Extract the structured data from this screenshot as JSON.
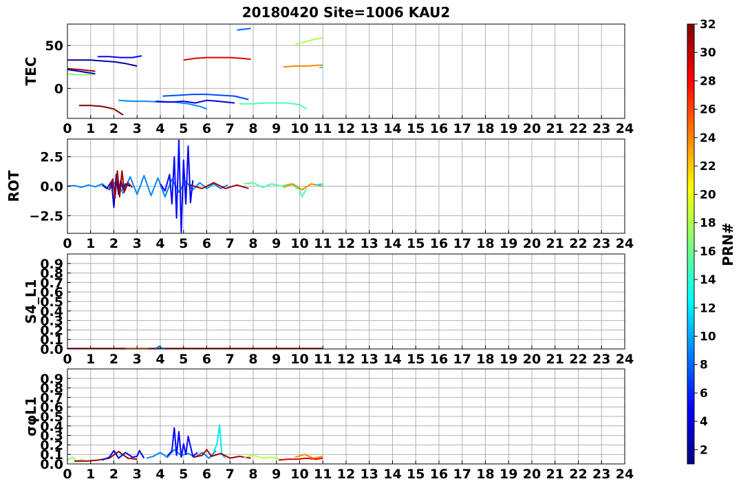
{
  "figure": {
    "title": "20180420 Site=1006 KAU2"
  },
  "colors": {
    "grid": "#b0b0b0",
    "jet": [
      "#00007f",
      "#0000ff",
      "#007fff",
      "#00ffff",
      "#7fff7f",
      "#ffff00",
      "#ff7f00",
      "#ff0000",
      "#7f0000"
    ]
  },
  "colorbar": {
    "label": "PRN#",
    "range": [
      1,
      32
    ],
    "ticks": [
      2,
      4,
      6,
      8,
      10,
      12,
      14,
      16,
      18,
      20,
      22,
      24,
      26,
      28,
      30,
      32
    ]
  },
  "chart_data": [
    {
      "type": "line",
      "ylabel": "TEC",
      "xlim": [
        0,
        24
      ],
      "ylim": [
        -35,
        75
      ],
      "xticks": [
        0,
        1,
        2,
        3,
        4,
        5,
        6,
        7,
        8,
        9,
        10,
        11,
        12,
        13,
        14,
        15,
        16,
        17,
        18,
        19,
        20,
        21,
        22,
        23,
        24
      ],
      "yticks": [
        {
          "v": 0,
          "label": "0"
        },
        {
          "v": 50,
          "label": "50"
        }
      ],
      "grid": true,
      "series": [
        {
          "prn": 31,
          "x": [
            0,
            0.5,
            1.2
          ],
          "y": [
            23,
            22,
            20
          ]
        },
        {
          "prn": 3,
          "x": [
            0,
            0.5,
            1.2
          ],
          "y": [
            22,
            20,
            17
          ]
        },
        {
          "prn": 17,
          "x": [
            0,
            0.5,
            1.1
          ],
          "y": [
            17,
            16,
            16
          ]
        },
        {
          "prn": 2,
          "x": [
            0,
            0.5,
            1,
            1.5,
            2,
            2.5,
            3
          ],
          "y": [
            33,
            33,
            33,
            32,
            31,
            29,
            26
          ]
        },
        {
          "prn": 5,
          "x": [
            1.3,
            1.8,
            2.3,
            2.8,
            3.2
          ],
          "y": [
            37,
            37,
            36,
            36,
            38
          ]
        },
        {
          "prn": 32,
          "x": [
            0.5,
            1,
            1.5,
            2,
            2.4
          ],
          "y": [
            -20,
            -20,
            -21,
            -24,
            -31
          ]
        },
        {
          "prn": 9,
          "x": [
            2.2,
            2.8,
            3.4,
            4,
            4.6,
            5.2,
            5.7,
            6
          ],
          "y": [
            -14,
            -15,
            -15,
            -16,
            -16,
            -18,
            -21,
            -24
          ]
        },
        {
          "prn": 4,
          "x": [
            3.8,
            4.5,
            5,
            5.5,
            6,
            6.5,
            7.2
          ],
          "y": [
            -15,
            -16,
            -15,
            -17,
            -14,
            -15,
            -17
          ]
        },
        {
          "prn": 7,
          "x": [
            4.1,
            4.8,
            5.4,
            6,
            6.6,
            7.2,
            7.8
          ],
          "y": [
            -9,
            -8,
            -7,
            -7,
            -8,
            -9,
            -13
          ]
        },
        {
          "prn": 29,
          "x": [
            5,
            5.5,
            6,
            6.5,
            7,
            7.5,
            7.9
          ],
          "y": [
            33,
            35,
            36,
            36,
            36,
            35,
            34
          ]
        },
        {
          "prn": 8,
          "x": [
            7.3,
            7.6,
            7.9
          ],
          "y": [
            68,
            69,
            70
          ]
        },
        {
          "prn": 15,
          "x": [
            7.4,
            8,
            8.5,
            9,
            9.5,
            10,
            10.3
          ],
          "y": [
            -18,
            -18,
            -17,
            -17,
            -17,
            -19,
            -24
          ]
        },
        {
          "prn": 24,
          "x": [
            9.3,
            9.8,
            10.3,
            10.8,
            11
          ],
          "y": [
            25,
            26,
            26,
            27,
            27
          ]
        },
        {
          "prn": 18,
          "x": [
            9.8,
            10.2,
            10.6,
            11
          ],
          "y": [
            51,
            54,
            57,
            59
          ]
        },
        {
          "prn": 12,
          "x": [
            10.85,
            11
          ],
          "y": [
            24,
            25
          ]
        }
      ]
    },
    {
      "type": "line",
      "ylabel": "ROT",
      "xlim": [
        0,
        24
      ],
      "ylim": [
        -4,
        4
      ],
      "xticks": [
        0,
        1,
        2,
        3,
        4,
        5,
        6,
        7,
        8,
        9,
        10,
        11,
        12,
        13,
        14,
        15,
        16,
        17,
        18,
        19,
        20,
        21,
        22,
        23,
        24
      ],
      "yticks": [
        {
          "v": 2.5,
          "label": "2.5"
        },
        {
          "v": 0,
          "label": "0.0"
        },
        {
          "v": -2.5,
          "label": "−2.5"
        }
      ],
      "grid": true,
      "series": [
        {
          "prn": 9,
          "x": [
            0,
            0.3,
            0.6,
            0.9,
            1.2,
            1.5,
            1.8,
            2.1,
            2.4,
            2.7,
            3,
            3.3,
            3.6,
            3.9,
            4.2,
            4.5,
            4.8,
            5.1,
            5.4,
            5.7,
            6,
            6.3,
            6.6,
            6.9
          ],
          "y": [
            0,
            0.05,
            -0.1,
            0.1,
            -0.05,
            0.2,
            -0.3,
            0.4,
            -0.6,
            0.8,
            -0.7,
            0.9,
            -0.8,
            0.7,
            -0.9,
            0.6,
            -0.5,
            0.4,
            -0.3,
            0.3,
            -0.2,
            0.2,
            -0.2,
            0.1
          ]
        },
        {
          "prn": 3,
          "x": [
            1.5,
            1.7,
            1.9,
            2,
            2.1,
            2.2,
            2.3,
            2.4,
            2.5,
            2.7
          ],
          "y": [
            0.1,
            -0.2,
            0.4,
            -1.8,
            1,
            -0.7,
            0.5,
            -0.3,
            0.2,
            0
          ]
        },
        {
          "prn": 31,
          "x": [
            1.8,
            1.95,
            2.05,
            2.15,
            2.25,
            2.35,
            2.45,
            2.6,
            2.8
          ],
          "y": [
            -0.3,
            0.6,
            -1,
            1.3,
            -0.9,
            1.3,
            -0.5,
            0.3,
            -0.1
          ]
        },
        {
          "prn": 5,
          "x": [
            4,
            4.2,
            4.4,
            4.5,
            4.6,
            4.7,
            4.8,
            4.9,
            5,
            5.1,
            5.2,
            5.3,
            5.4
          ],
          "y": [
            0.2,
            -0.4,
            1,
            -1.5,
            2.5,
            -2.7,
            3.9,
            -3.9,
            2.2,
            -1.5,
            3.4,
            -1.4,
            0.5
          ]
        },
        {
          "prn": 31,
          "x": [
            5.3,
            5.8,
            6.3,
            6.8,
            7.3,
            7.8
          ],
          "y": [
            0.1,
            -0.2,
            0.3,
            -0.2,
            0.1,
            -0.2
          ]
        },
        {
          "prn": 15,
          "x": [
            7.6,
            8,
            8.4,
            8.8,
            9.2,
            9.6,
            10,
            10.1,
            10.3
          ],
          "y": [
            0.2,
            0.3,
            -0.1,
            0.2,
            0,
            0.2,
            -0.3,
            -0.9,
            -0.2
          ]
        },
        {
          "prn": 24,
          "x": [
            9.3,
            9.7,
            10.1,
            10.5,
            11
          ],
          "y": [
            -0.1,
            0.2,
            -0.3,
            0.2,
            0
          ]
        },
        {
          "prn": 12,
          "x": [
            10.7,
            11
          ],
          "y": [
            0.1,
            0.2
          ]
        }
      ]
    },
    {
      "type": "line",
      "ylabel": "S4_L1",
      "xlim": [
        0,
        24
      ],
      "ylim": [
        0,
        1
      ],
      "xticks": [
        0,
        1,
        2,
        3,
        4,
        5,
        6,
        7,
        8,
        9,
        10,
        11,
        12,
        13,
        14,
        15,
        16,
        17,
        18,
        19,
        20,
        21,
        22,
        23,
        24
      ],
      "yticks": [
        {
          "v": 0,
          "label": "0.0"
        },
        {
          "v": 0.1,
          "label": "0.1"
        },
        {
          "v": 0.2,
          "label": "0.2"
        },
        {
          "v": 0.3,
          "label": "0.3"
        },
        {
          "v": 0.4,
          "label": "0.4"
        },
        {
          "v": 0.5,
          "label": "0.5"
        },
        {
          "v": 0.6,
          "label": "0.6"
        },
        {
          "v": 0.7,
          "label": "0.7"
        },
        {
          "v": 0.8,
          "label": "0.8"
        },
        {
          "v": 0.9,
          "label": "0.9"
        }
      ],
      "grid": true,
      "series": [
        {
          "prn": 31,
          "x": [
            0,
            2,
            4,
            6,
            8,
            10,
            11
          ],
          "y": [
            0.005,
            0.005,
            0.005,
            0.005,
            0.005,
            0.005,
            0.005
          ]
        },
        {
          "prn": 9,
          "x": [
            3.8,
            3.95,
            4.05,
            4.2
          ],
          "y": [
            0.005,
            0.03,
            0.01,
            0.005
          ]
        },
        {
          "prn": 24,
          "x": [
            2.5,
            3.5
          ],
          "y": [
            0.005,
            0.005
          ]
        }
      ]
    },
    {
      "type": "line",
      "ylabel": "σφL1",
      "xlim": [
        0,
        24
      ],
      "ylim": [
        0,
        1
      ],
      "xticks": [
        0,
        1,
        2,
        3,
        4,
        5,
        6,
        7,
        8,
        9,
        10,
        11,
        12,
        13,
        14,
        15,
        16,
        17,
        18,
        19,
        20,
        21,
        22,
        23,
        24
      ],
      "yticks": [
        {
          "v": 0,
          "label": "0.0"
        },
        {
          "v": 0.1,
          "label": "0.1"
        },
        {
          "v": 0.2,
          "label": "0.2"
        },
        {
          "v": 0.3,
          "label": "0.3"
        },
        {
          "v": 0.4,
          "label": "0.4"
        },
        {
          "v": 0.5,
          "label": "0.5"
        },
        {
          "v": 0.6,
          "label": "0.6"
        },
        {
          "v": 0.7,
          "label": "0.7"
        },
        {
          "v": 0.8,
          "label": "0.8"
        },
        {
          "v": 0.9,
          "label": "0.9"
        }
      ],
      "grid": true,
      "series": [
        {
          "prn": 17,
          "x": [
            0,
            0.2,
            0.4,
            0.7
          ],
          "y": [
            0.04,
            0.07,
            0.03,
            0.05
          ]
        },
        {
          "prn": 31,
          "x": [
            0.3,
            0.8,
            1.3,
            1.8,
            2.2,
            2.6,
            3
          ],
          "y": [
            0.03,
            0.03,
            0.04,
            0.06,
            0.13,
            0.06,
            0.05
          ]
        },
        {
          "prn": 4,
          "x": [
            1.5,
            1.8,
            2,
            2.2,
            2.5,
            2.8,
            3,
            3.1,
            3.3
          ],
          "y": [
            0.04,
            0.07,
            0.14,
            0.06,
            0.12,
            0.07,
            0.08,
            0.14,
            0.06
          ]
        },
        {
          "prn": 9,
          "x": [
            3.4,
            3.7,
            4,
            4.3,
            4.6,
            4.9,
            5.2,
            5.5,
            5.8,
            6.1,
            6.4
          ],
          "y": [
            0.06,
            0.08,
            0.12,
            0.07,
            0.15,
            0.09,
            0.11,
            0.07,
            0.12,
            0.06,
            0.14
          ]
        },
        {
          "prn": 5,
          "x": [
            4.3,
            4.5,
            4.6,
            4.7,
            4.8,
            4.9,
            5,
            5.1,
            5.2,
            5.4,
            5.6
          ],
          "y": [
            0.08,
            0.14,
            0.38,
            0.09,
            0.34,
            0.07,
            0.21,
            0.1,
            0.29,
            0.08,
            0.12
          ]
        },
        {
          "prn": 12,
          "x": [
            6.3,
            6.45,
            6.55,
            6.65,
            6.8
          ],
          "y": [
            0.12,
            0.22,
            0.41,
            0.1,
            0.06
          ]
        },
        {
          "prn": 31,
          "x": [
            5.4,
            5.8,
            6,
            6.2,
            6.6,
            7,
            7.4,
            7.9
          ],
          "y": [
            0.07,
            0.09,
            0.15,
            0.08,
            0.11,
            0.06,
            0.08,
            0.06
          ]
        },
        {
          "prn": 18,
          "x": [
            7.6,
            8,
            8.4,
            8.8,
            9.2
          ],
          "y": [
            0.07,
            0.09,
            0.06,
            0.07,
            0.05
          ]
        },
        {
          "prn": 29,
          "x": [
            9.1,
            9.5,
            9.9,
            10.3,
            10.7,
            11
          ],
          "y": [
            0.04,
            0.05,
            0.05,
            0.06,
            0.05,
            0.06
          ]
        },
        {
          "prn": 24,
          "x": [
            9.8,
            10.2,
            10.6,
            11
          ],
          "y": [
            0.07,
            0.1,
            0.06,
            0.08
          ]
        }
      ]
    }
  ]
}
